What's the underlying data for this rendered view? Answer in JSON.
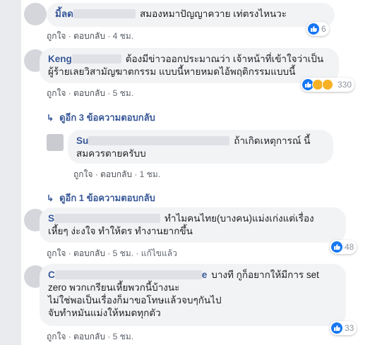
{
  "comments": [
    {
      "name": "มิ้ลด",
      "text": "สมองหมาปัญญาควาย เท่ตรงไหนวะ",
      "like": "ถูกใจ",
      "reply": "ตอบกลับ",
      "time": "4 ชม.",
      "reactions": "6"
    },
    {
      "name": "Keng",
      "text_line1": "ต้องมีข่าวออกประมาณว่า เจ้าหน้าที่เข้าใจว่าเป็น",
      "text_line2": "ผู้ร้ายเลยวิสามัญฆาตกรรม แบบนี้หายหมดไอ้พฤติกรรมแบบนี้",
      "like": "ถูกใจ",
      "reply": "ตอบกลับ",
      "time": "5 ชม.",
      "reactions": "330"
    },
    {
      "name": "Su",
      "text_line1": "ถ้าเกิดเหตุการณ์ นี้",
      "text_line2": "สมควรตายครับบ",
      "like": "ถูกใจ",
      "reply": "ตอบกลับ",
      "time": "1 ชม."
    },
    {
      "name": "S",
      "text_line1": "ทำไมคนไทย(บางคน)แม่งเก่งแต่เรื่อง",
      "text_line2": "เหี้ยๆ ง่ะงใจ ทำให้ตร ทำงานยากขึ้น",
      "like": "ถูกใจ",
      "reply": "ตอบกลับ",
      "time": "5 ชม.",
      "edited": "แก้ไขแล้ว",
      "reactions": "48"
    },
    {
      "name": "C",
      "name_end": "e",
      "text_line1": "บางที กูก็อยากให้มีการ set",
      "text_line2": "zero พวกเกรียนเหี้ยพวกนี้บ้างนะ",
      "text_line3": "ไม่ใช่พอเป็นเรื่องก็มาขอโทษแล้วจบๆกันไป",
      "text_line4": "จับทำหมันแม่งให้หมดทุกตัว",
      "like": "ถูกใจ",
      "reply": "ตอบกลับ",
      "time": "5 ชม.",
      "reactions": "33"
    }
  ],
  "more_replies_1": "ดูอีก 3 ข้อความตอบกลับ",
  "more_replies_2": "ดูอีก 1 ข้อความตอบกลับ",
  "separator": "·",
  "icons": {
    "like": "thumbs-up-icon",
    "haha": "haha-icon",
    "wow": "wow-icon",
    "reply_arrow": "reply-arrow-icon"
  },
  "colors": {
    "link": "#385898",
    "bubble": "#f2f3f5",
    "like_blue": "#1877f2"
  }
}
